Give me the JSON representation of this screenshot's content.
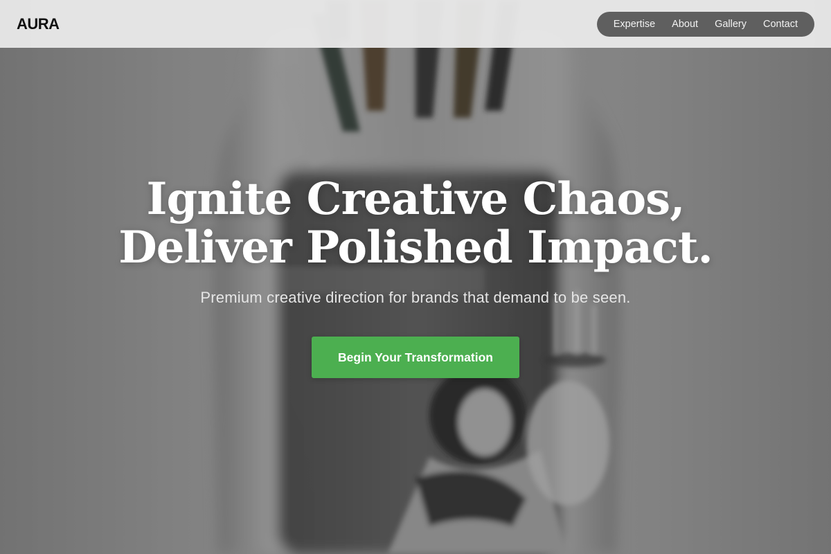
{
  "header": {
    "logo": "AURA",
    "nav": [
      {
        "label": "Expertise"
      },
      {
        "label": "About"
      },
      {
        "label": "Gallery"
      },
      {
        "label": "Contact"
      }
    ]
  },
  "hero": {
    "title_line_1": "Ignite Creative Chaos,",
    "title_line_2": "Deliver Polished Impact.",
    "subtitle": "Premium creative direction for brands that demand to be seen.",
    "cta_label": "Begin Your Transformation"
  },
  "colors": {
    "accent": "#4caf50",
    "nav_pill": "#5f5f5f",
    "header_bg": "#e8e8e8",
    "title": "#ffffff"
  }
}
